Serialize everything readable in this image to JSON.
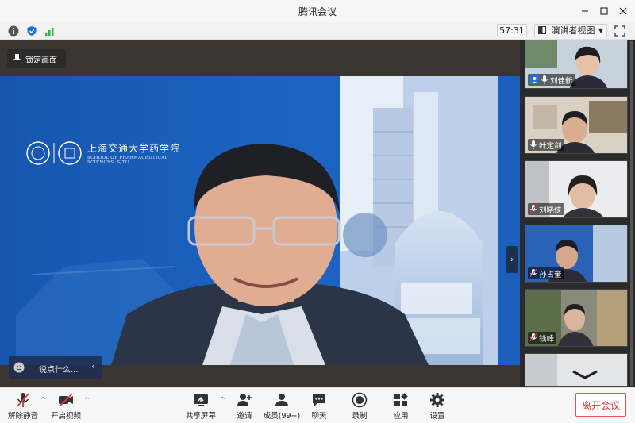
{
  "window": {
    "title": "腾讯会议",
    "controls": [
      "minimize-icon",
      "maximize-icon",
      "close-icon"
    ]
  },
  "toolbar": {
    "icons": [
      "info-icon",
      "shield-icon",
      "signal-icon"
    ],
    "timer": "57:31",
    "view_mode": "演讲者视图"
  },
  "stage": {
    "lock_label": "锁定画面",
    "logo_cn": "上海交通大学药学院",
    "logo_en": "SCHOOL OF PHARMACEUTICAL SCIENCES, SJTU",
    "chat_placeholder": "说点什么..."
  },
  "participants": [
    {
      "name": "刘佳新",
      "mic": "on",
      "host": true
    },
    {
      "name": "叶定剑",
      "mic": "on",
      "host": false
    },
    {
      "name": "刘晓侠",
      "mic": "muted",
      "host": false
    },
    {
      "name": "孙占奎",
      "mic": "muted",
      "host": false
    },
    {
      "name": "钱峰",
      "mic": "muted",
      "host": false
    }
  ],
  "bottombar": {
    "unmute": "解除静音",
    "start_video": "开启视频",
    "share_screen": "共享屏幕",
    "invite": "邀请",
    "members": "成员(99+)",
    "chat": "聊天",
    "record": "录制",
    "apps": "应用",
    "settings": "设置",
    "leave": "离开会议"
  },
  "colors": {
    "accent_blue": "#1c63bf",
    "leave_red": "#d03b3b",
    "mute_red": "#e03a3a"
  }
}
